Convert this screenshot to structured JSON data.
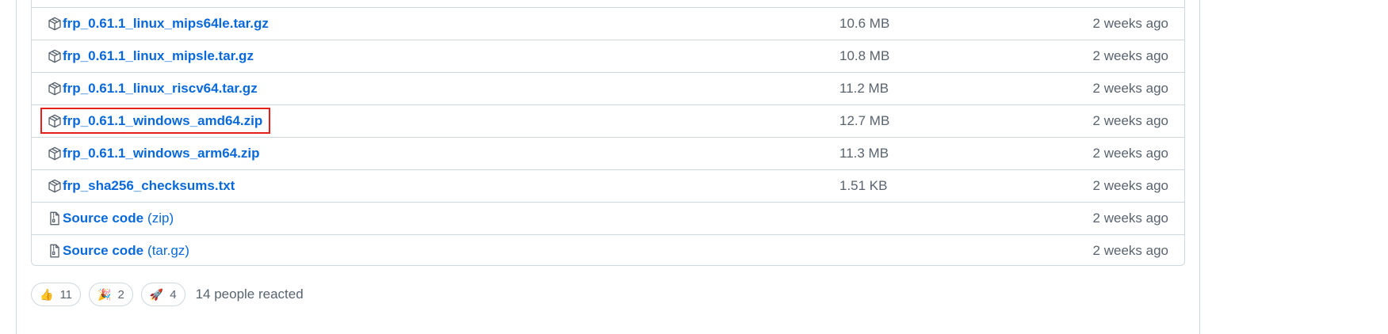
{
  "assets": [
    {
      "name": "frp_0.61.1_linux_mips64le.tar.gz",
      "suffix": "",
      "size": "10.6 MB",
      "date": "2 weeks ago",
      "icon": "package-icon"
    },
    {
      "name": "frp_0.61.1_linux_mipsle.tar.gz",
      "suffix": "",
      "size": "10.8 MB",
      "date": "2 weeks ago",
      "icon": "package-icon"
    },
    {
      "name": "frp_0.61.1_linux_riscv64.tar.gz",
      "suffix": "",
      "size": "11.2 MB",
      "date": "2 weeks ago",
      "icon": "package-icon"
    },
    {
      "name": "frp_0.61.1_windows_amd64.zip",
      "suffix": "",
      "size": "12.7 MB",
      "date": "2 weeks ago",
      "icon": "package-icon"
    },
    {
      "name": "frp_0.61.1_windows_arm64.zip",
      "suffix": "",
      "size": "11.3 MB",
      "date": "2 weeks ago",
      "icon": "package-icon"
    },
    {
      "name": "frp_sha256_checksums.txt",
      "suffix": "",
      "size": "1.51 KB",
      "date": "2 weeks ago",
      "icon": "package-icon"
    },
    {
      "name": "Source code",
      "suffix": "(zip)",
      "size": "",
      "date": "2 weeks ago",
      "icon": "file-zip-icon"
    },
    {
      "name": "Source code",
      "suffix": "(tar.gz)",
      "size": "",
      "date": "2 weeks ago",
      "icon": "file-zip-icon"
    }
  ],
  "reactions": [
    {
      "emoji": "👍",
      "count": "11",
      "icon": "thumbs-up-icon"
    },
    {
      "emoji": "🎉",
      "count": "2",
      "icon": "tada-icon"
    },
    {
      "emoji": "🚀",
      "count": "4",
      "icon": "rocket-icon"
    }
  ],
  "reaction_summary": "14 people reacted",
  "colors": {
    "link": "#0969da",
    "muted": "#59636e",
    "border": "#d0d7de",
    "highlight": "#e5201b"
  }
}
